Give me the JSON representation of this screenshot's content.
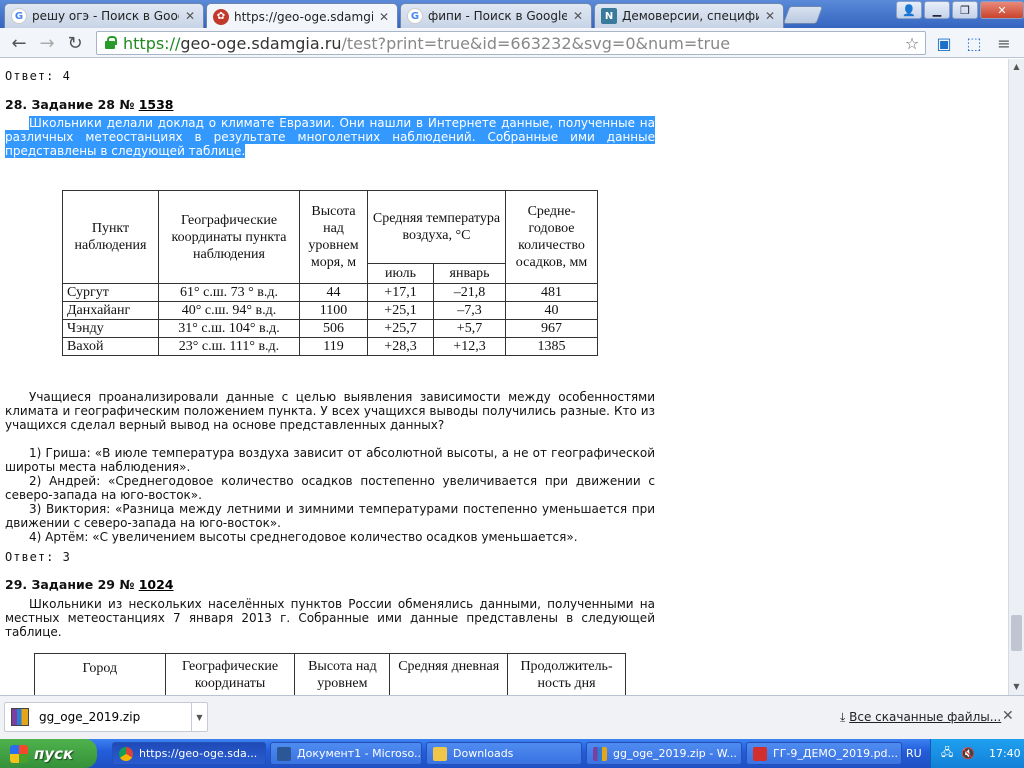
{
  "browser": {
    "tabs": [
      {
        "title": "решу огэ - Поиск в Google",
        "icon": "google-icon",
        "active": false
      },
      {
        "title": "https://geo-oge.sdamgia.ru/",
        "icon": "sdamgia-icon",
        "active": true
      },
      {
        "title": "фипи - Поиск в Google",
        "icon": "google-icon",
        "active": false
      },
      {
        "title": "Демоверсии, спецификаци",
        "icon": "fipi-icon",
        "active": false
      }
    ],
    "url": {
      "scheme": "https://",
      "host": "geo-oge.sdamgia.ru",
      "path": "/test?print=true&id=663232&svg=0&num=true"
    }
  },
  "page": {
    "prev_answer": "Ответ: 4",
    "q28": {
      "heading": "28. Задание 28 №",
      "num": "1538",
      "intro": "Школьники делали доклад о климате Евразии. Они нашли в Интернете данные, полученные на различных метеостанциях в результате многолетних наблюдений. Собранные ими данные представлены в следующей таблице.",
      "table": {
        "headers": {
          "point": "Пункт наблюдения",
          "coords": "Географические координаты пункта наблюдения",
          "height": "Высота над уровнем моря, м",
          "temp": "Средняя температура воздуха, °С",
          "july": "июль",
          "january": "январь",
          "precip": "Средне-годовое количество осадков, мм"
        },
        "rows": [
          {
            "name": "Сургут",
            "coords": "61° с.ш. 73 ° в.д.",
            "height": "44",
            "july": "+17,1",
            "january": "–21,8",
            "precip": "481"
          },
          {
            "name": "Данхайанг",
            "coords": "40° с.ш. 94° в.д.",
            "height": "1100",
            "july": "+25,1",
            "january": "–7,3",
            "precip": "40"
          },
          {
            "name": "Чэнду",
            "coords": "31° с.ш. 104° в.д.",
            "height": "506",
            "july": "+25,7",
            "january": "+5,7",
            "precip": "967"
          },
          {
            "name": "Вахой",
            "coords": "23° с.ш. 111° в.д.",
            "height": "119",
            "july": "+28,3",
            "january": "+12,3",
            "precip": "1385"
          }
        ]
      },
      "question": "Учащиеся проанализировали данные с целью выявления зависимости между особенностями климата и географическим положением пункта. У всех учащихся выводы получились разные. Кто из учащихся сделал верный вывод на основе представленных данных?",
      "options": [
        "1) Гриша: «В июле температура воздуха зависит от абсолютной высоты, а не от географической широты места наблюдения».",
        "2) Андрей: «Среднегодовое количество осадков постепенно увеличивается при движении с северо-запада на юго-восток».",
        "3) Виктория: «Разница между летними и зимними температурами постепенно уменьшается при движении с северо-запада на юго-восток».",
        "4) Артём: «С увеличением высоты среднегодовое количество осадков уменьшается»."
      ],
      "answer": "Ответ: 3"
    },
    "q29": {
      "heading": "29. Задание 29 №",
      "num": "1024",
      "intro": "Школьники из нескольких населённых пунктов России обменялись данными, полученными на местных метеостанциях 7 января 2013 г. Собранные ими данные представлены в следующей таблице.",
      "table_headers": {
        "city": "Город",
        "coords": "Географические координаты",
        "height": "Высота над уровнем",
        "temp": "Средняя дневная",
        "day": "Продолжитель-ность дня"
      }
    }
  },
  "downloads": {
    "file": "gg_oge_2019.zip",
    "all_label": "Все скачанные файлы..."
  },
  "taskbar": {
    "start": "пуск",
    "tasks": [
      {
        "label": "https://geo-oge.sda...",
        "icon": "chrome-icon"
      },
      {
        "label": "Документ1 - Microso...",
        "icon": "word-icon"
      },
      {
        "label": "Downloads",
        "icon": "folder-icon"
      },
      {
        "label": "gg_oge_2019.zip - W...",
        "icon": "winrar-icon"
      },
      {
        "label": "ГГ-9_ДЕМО_2019.pd...",
        "icon": "pdf-icon"
      }
    ],
    "lang": "RU",
    "time": "17:40"
  }
}
